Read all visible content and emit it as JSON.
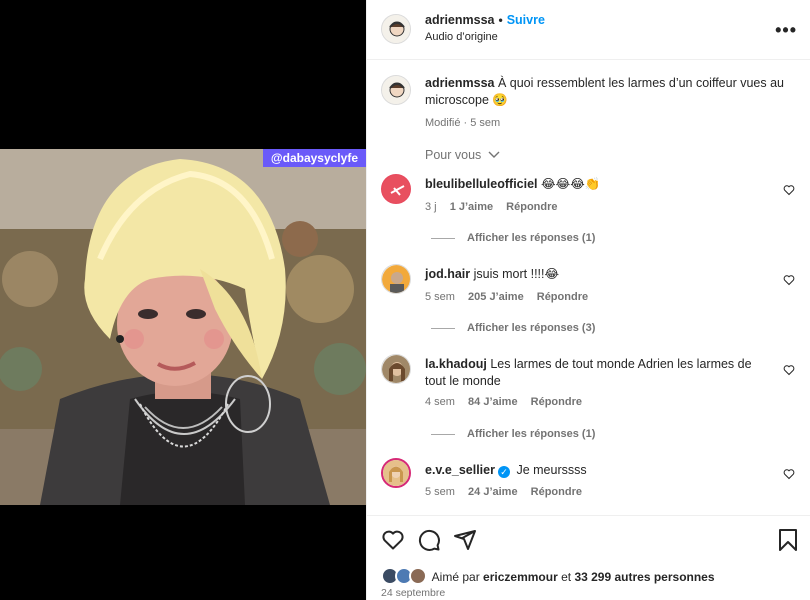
{
  "media": {
    "watermark": "@dabaysyclyfe"
  },
  "header": {
    "username": "adrienmssa",
    "separator": "•",
    "follow_label": "Suivre",
    "audio": "Audio d’origine",
    "more": "•••"
  },
  "caption": {
    "username": "adrienmssa",
    "text": "À quoi ressemblent les larmes d’un coiffeur vues au microscope 🥹",
    "meta": "Modifié · 5 sem"
  },
  "sort": {
    "label": "Pour vous"
  },
  "comments": [
    {
      "username": "bleulibelluleofficiel",
      "text": "😂😂😂👏",
      "age": "3 j",
      "likes": "1 J’aime",
      "reply": "Répondre",
      "replies": "Afficher les réponses (1)"
    },
    {
      "username": "jod.hair",
      "text": "jsuis mort !!!!😂",
      "age": "5 sem",
      "likes": "205 J’aime",
      "reply": "Répondre",
      "replies": "Afficher les réponses (3)"
    },
    {
      "username": "la.khadouj",
      "text": "Les larmes de tout monde Adrien les larmes de tout le monde",
      "age": "4 sem",
      "likes": "84 J’aime",
      "reply": "Répondre",
      "replies": "Afficher les réponses (1)"
    },
    {
      "username": "e.v.e_sellier",
      "text": "Je meurssss",
      "age": "5 sem",
      "likes": "24 J’aime",
      "reply": "Répondre"
    }
  ],
  "likes": {
    "prefix": "Aimé par",
    "user": "ericzemmour",
    "middle": "et",
    "others": "33 299 autres personnes"
  },
  "date": "24 septembre",
  "colors": {
    "accent": "#0095f6",
    "muted": "#737373",
    "watermark_bg": "#6a5af9"
  }
}
